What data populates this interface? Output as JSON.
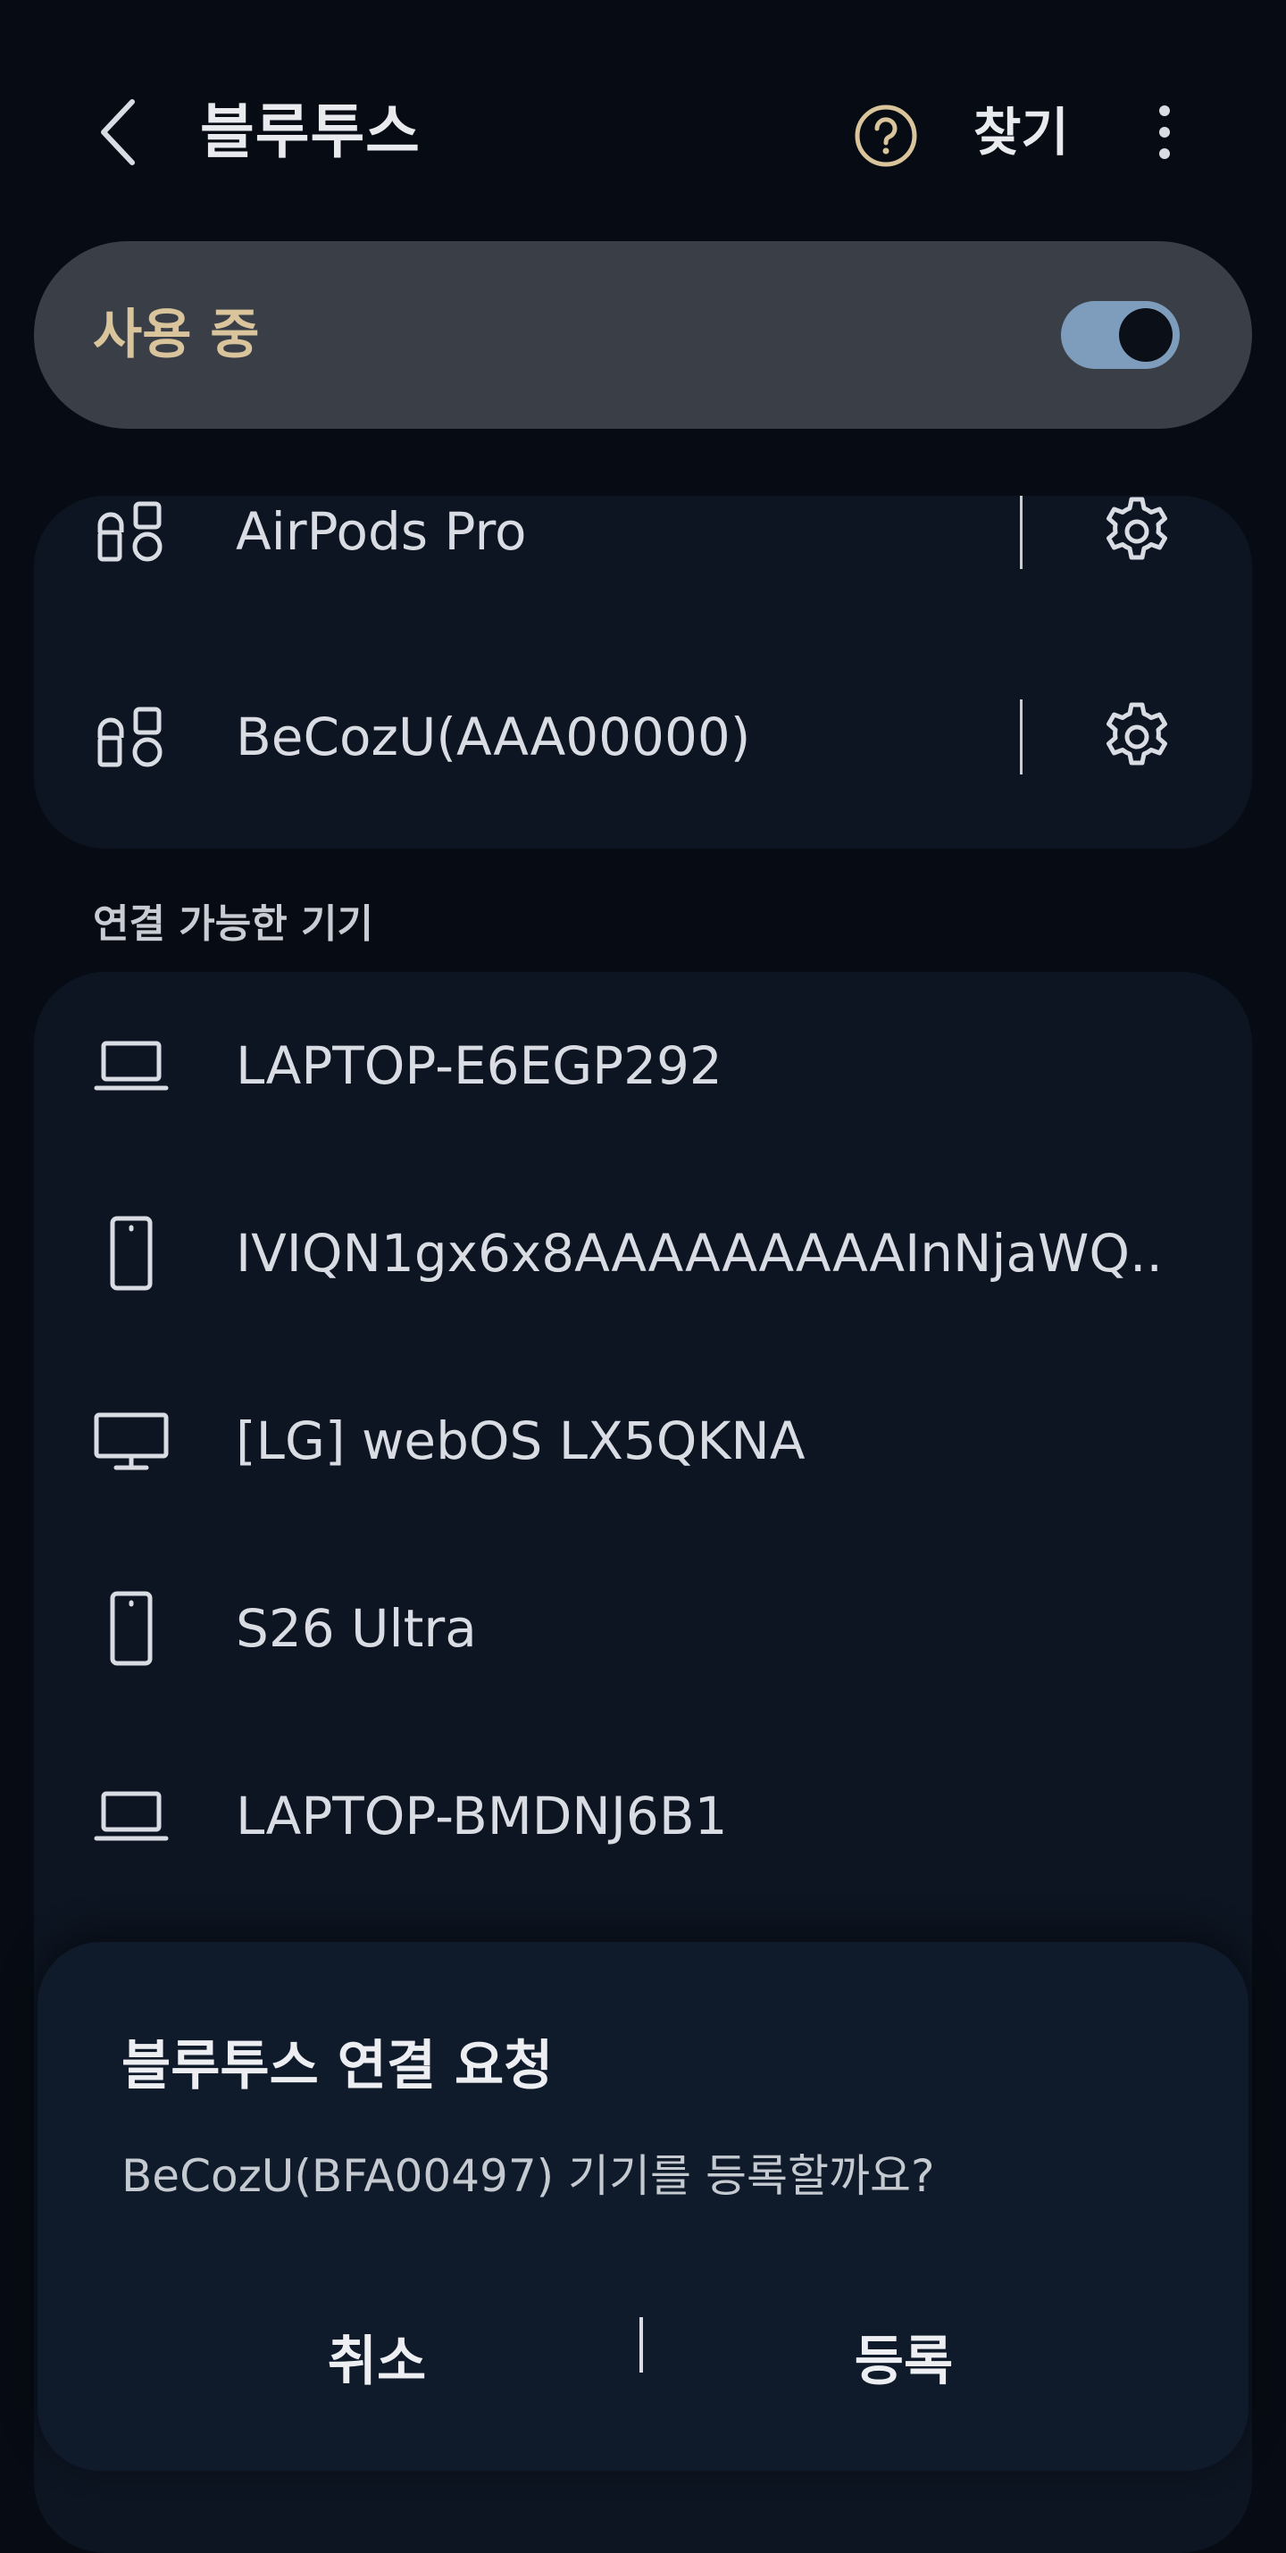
{
  "header": {
    "title": "블루투스",
    "search_label": "찾기",
    "back_icon": "chevron-left-icon",
    "help_icon": "help-circle-icon",
    "more_icon": "more-vertical-icon"
  },
  "master_switch": {
    "label": "사용 중",
    "on": true
  },
  "paired_devices": [
    {
      "name": "AirPods Pro",
      "icon": "earbuds-icon"
    },
    {
      "name": "BeCozU(AAA00000)",
      "icon": "earbuds-icon"
    }
  ],
  "available_section": {
    "header": "연결 가능한 기기",
    "devices": [
      {
        "name": "LAPTOP-E6EGP292",
        "icon": "laptop-icon"
      },
      {
        "name": "IVIQN1gx6x8AAAAAAAAAInNjaWQ..",
        "icon": "phone-icon"
      },
      {
        "name": "[LG] webOS LX5QKNA",
        "icon": "monitor-icon"
      },
      {
        "name": "S26 Ultra",
        "icon": "phone-icon"
      },
      {
        "name": "LAPTOP-BMDNJ6B1",
        "icon": "laptop-icon"
      }
    ]
  },
  "dialog": {
    "title": "블루투스 연결 요청",
    "message": "BeCozU(BFA00497) 기기를 등록할까요?",
    "cancel_label": "취소",
    "confirm_label": "등록"
  },
  "colors": {
    "background": "#070c14",
    "card": "#0d1522",
    "switch_card": "#3a3f47",
    "accent_gold": "#d9c49b",
    "toggle_track": "#7e9cbc"
  }
}
